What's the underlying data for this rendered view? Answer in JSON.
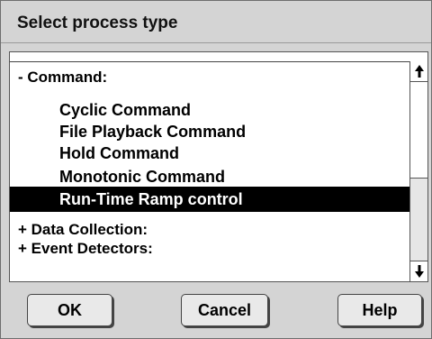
{
  "dialog": {
    "title": "Select process type"
  },
  "list": {
    "items": [
      {
        "label": "- Command:",
        "kind": "group",
        "selected": false
      },
      {
        "label": "Cyclic Command",
        "kind": "child",
        "selected": false
      },
      {
        "label": "File Playback Command",
        "kind": "child",
        "selected": false
      },
      {
        "label": "Hold Command",
        "kind": "child",
        "selected": false
      },
      {
        "label": "Monotonic Command",
        "kind": "child",
        "selected": false
      },
      {
        "label": "Run-Time Ramp control",
        "kind": "child",
        "selected": true
      },
      {
        "label": "+ Data Collection:",
        "kind": "group",
        "selected": false
      },
      {
        "label": "+ Event Detectors:",
        "kind": "group",
        "selected": false
      }
    ]
  },
  "scrollbar": {
    "up_icon": "arrow-up-icon",
    "down_icon": "arrow-down-icon",
    "position": 0
  },
  "buttons": {
    "ok_label": "OK",
    "cancel_label": "Cancel",
    "help_label": "Help"
  },
  "colors": {
    "dialog_bg": "#d4d4d4",
    "list_bg": "#ffffff",
    "selection_bg": "#000000",
    "selection_fg": "#ffffff"
  }
}
